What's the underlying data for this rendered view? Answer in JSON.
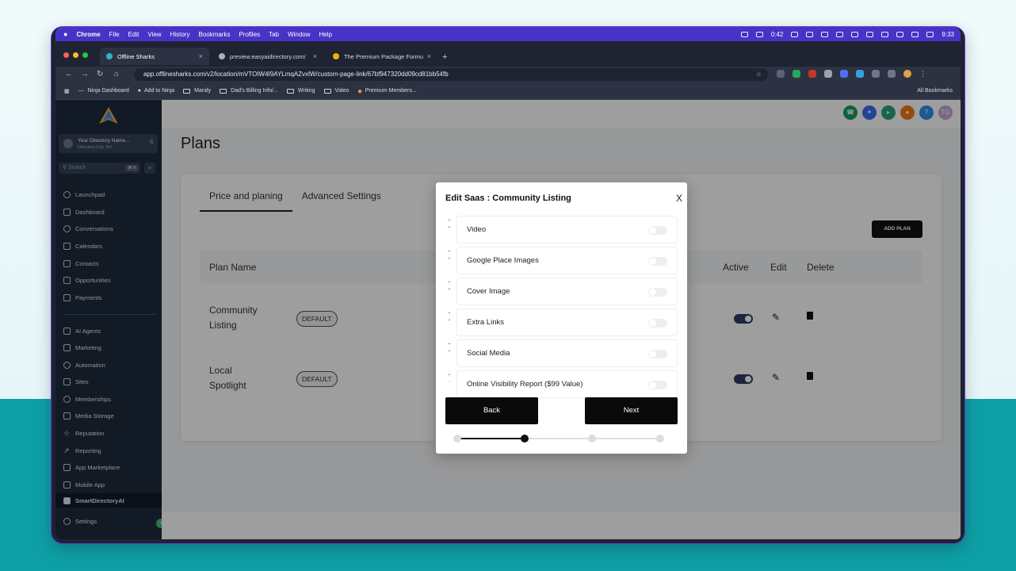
{
  "menubar": {
    "apple": "",
    "items": [
      "Chrome",
      "File",
      "Edit",
      "View",
      "History",
      "Bookmarks",
      "Profiles",
      "Tab",
      "Window",
      "Help"
    ],
    "timer": "0:42",
    "clock": "9:33"
  },
  "tabs": [
    {
      "title": "Offline Sharks",
      "active": true,
      "fav_color": "#2fb4c9"
    },
    {
      "title": "preview.easyaidirectory.com/",
      "active": false,
      "fav_color": "#aab0bd"
    },
    {
      "title": "The Premium Package Formu",
      "active": false,
      "fav_color": "#f4b400"
    }
  ],
  "address": {
    "url": "app.offlinesharks.com/v2/location/mVTOIW4I9AYLmqAZvxlW/custom-page-link/67bf947320dd09cd81bb54fb"
  },
  "bookmarks": {
    "items": [
      "Ninja Dashboard",
      "Add to Ninja",
      "Mandy",
      "Dad's Billing Info/...",
      "Writing",
      "Video",
      "Premium Members..."
    ],
    "all": "All Bookmarks"
  },
  "sidebar": {
    "account_name": "Your Directory Name...",
    "account_sub": "Directory City, NV",
    "search_placeholder": "Search",
    "search_kbd": "⌘ K",
    "group1": [
      "Launchpad",
      "Dashboard",
      "Conversations",
      "Calendars",
      "Contacts",
      "Opportunities",
      "Payments"
    ],
    "group2": [
      "AI Agents",
      "Marketing",
      "Automation",
      "Sites",
      "Memberships",
      "Media Storage",
      "Reputation",
      "Reporting",
      "App Marketplace",
      "Mobile App"
    ],
    "active_item": "SmartDirectoryAI",
    "settings": "Settings"
  },
  "topbar": {
    "avatar_initials": "TG",
    "help": "?"
  },
  "page": {
    "title": "Plans",
    "tabs": [
      "Price and planing",
      "Advanced Settings"
    ],
    "add_plan": "ADD PLAN",
    "columns": {
      "plan_name": "Plan Name",
      "active": "Active",
      "edit": "Edit",
      "delete": "Delete"
    },
    "plans": [
      {
        "name_line1": "Community",
        "name_line2": "Listing",
        "badge": "DEFAULT",
        "active": true
      },
      {
        "name_line1": "Local",
        "name_line2": "Spotlight",
        "badge": "DEFAULT",
        "active": true
      }
    ]
  },
  "modal": {
    "title": "Edit Saas : Community Listing",
    "close": "X",
    "features": [
      {
        "label": "Video",
        "enabled": false
      },
      {
        "label": "Google Place Images",
        "enabled": false
      },
      {
        "label": "Cover Image",
        "enabled": false
      },
      {
        "label": "Extra Links",
        "enabled": false
      },
      {
        "label": "Social Media",
        "enabled": false
      },
      {
        "label": "Online Visibility Report ($99 Value)",
        "enabled": false
      }
    ],
    "back": "Back",
    "next": "Next",
    "step_current": 2,
    "step_total": 4
  }
}
